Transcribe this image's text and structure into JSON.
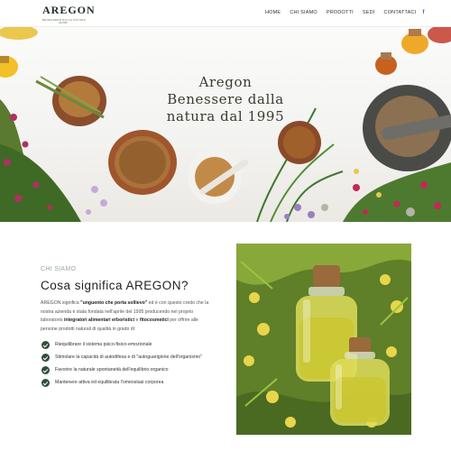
{
  "brand": {
    "name": "AREGON",
    "tagline": "BENESSERE DALLA NATURA",
    "since": "dal 1995"
  },
  "nav": {
    "items": [
      {
        "label": "HOME"
      },
      {
        "label": "CHI SIAMO"
      },
      {
        "label": "PRODOTTI"
      },
      {
        "label": "SEDI"
      },
      {
        "label": "CONTATTACI"
      }
    ],
    "facebook": "f"
  },
  "hero": {
    "title_line1": "Aregon",
    "title_line2": "Benessere dalla",
    "title_line3": "natura dal 1995"
  },
  "about": {
    "eyebrow": "CHI SIAMO",
    "title": "Cosa significa AREGON?",
    "body_a": "AREGON significa ",
    "body_b": "\"unguento che porta sollievo\"",
    "body_c": " ed è con questo credo che la nostra azienda è stata fondata nell'aprile del 1995 producendo nel proprio laboratorio ",
    "body_d": "integratori alimentari erboristici",
    "body_e": " e ",
    "body_f": "fitocosmetici",
    "body_g": " per offrire alle persone prodotti naturali di qualità in grado di:",
    "bullets": [
      "Riequilibrare il sistema psico-fisico-emozionale",
      "Stimolare la capacità di autodifesa e di \"autoguarigione dell'organismo\"",
      "Favorire la naturale spontaneità dell'equilibrio organico",
      "Mantenere attiva ed equilibrata l'omeostasi corporea"
    ]
  },
  "colors": {
    "brand_green": "#2f4f3a",
    "nav_text": "#333333",
    "facebook": "#3b5998"
  }
}
